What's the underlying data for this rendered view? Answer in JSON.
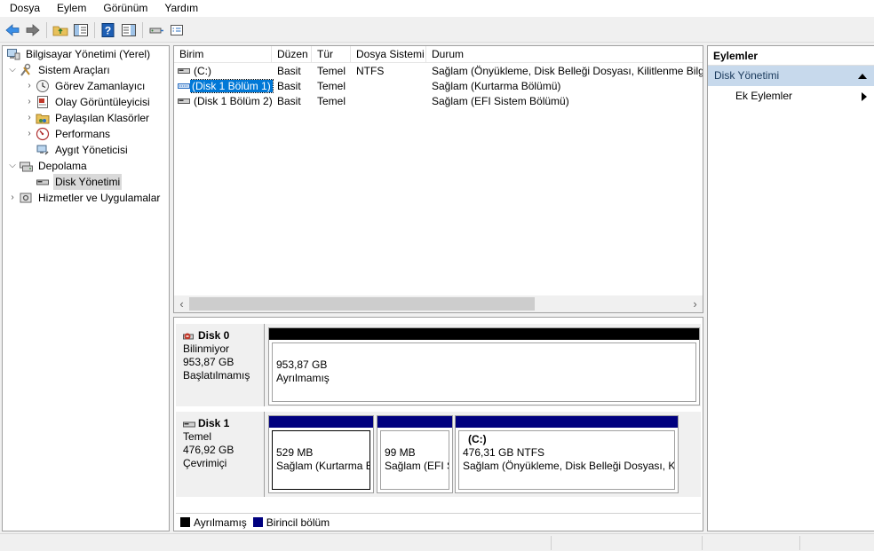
{
  "menu": [
    "Dosya",
    "Eylem",
    "Görünüm",
    "Yardım"
  ],
  "tree": {
    "root": "Bilgisayar Yönetimi (Yerel)",
    "system_tools": "Sistem Araçları",
    "task_scheduler": "Görev Zamanlayıcı",
    "event_viewer": "Olay Görüntüleyicisi",
    "shared_folders": "Paylaşılan Klasörler",
    "performance": "Performans",
    "device_manager": "Aygıt Yöneticisi",
    "storage": "Depolama",
    "disk_management": "Disk Yönetimi",
    "services": "Hizmetler ve Uygulamalar"
  },
  "list": {
    "columns": [
      "Birim",
      "Düzen",
      "Tür",
      "Dosya Sistemi",
      "Durum"
    ],
    "rows": [
      {
        "volume": "(C:)",
        "layout": "Basit",
        "type": "Temel",
        "fs": "NTFS",
        "status": "Sağlam (Önyükleme, Disk Belleği Dosyası, Kilitlenme Bilgisi"
      },
      {
        "volume": "(Disk 1 Bölüm 1)",
        "layout": "Basit",
        "type": "Temel",
        "fs": "",
        "status": "Sağlam (Kurtarma Bölümü)"
      },
      {
        "volume": "(Disk 1 Bölüm 2)",
        "layout": "Basit",
        "type": "Temel",
        "fs": "",
        "status": "Sağlam (EFI Sistem Bölümü)"
      }
    ]
  },
  "disks": [
    {
      "name": "Disk 0",
      "kind": "Bilinmiyor",
      "size": "953,87 GB",
      "state": "Başlatılmamış",
      "volumes": [
        {
          "name": "",
          "size": "953,87 GB",
          "desc": "Ayrılmamış"
        }
      ]
    },
    {
      "name": "Disk 1",
      "kind": "Temel",
      "size": "476,92 GB",
      "state": "Çevrimiçi",
      "volumes": [
        {
          "name": "",
          "size": "529 MB",
          "desc": "Sağlam (Kurtarma B"
        },
        {
          "name": "",
          "size": "99 MB",
          "desc": "Sağlam (EFI Si"
        },
        {
          "name": "(C:)",
          "size": "476,31 GB NTFS",
          "desc": "Sağlam (Önyükleme, Disk Belleği Dosyası, Kili"
        }
      ]
    }
  ],
  "legend": {
    "unallocated": "Ayrılmamış",
    "primary": "Birincil bölüm"
  },
  "actions": {
    "title": "Eylemler",
    "section": "Disk Yönetimi",
    "more": "Ek Eylemler"
  },
  "colors": {
    "unallocated": "#000000",
    "primary": "#00007f",
    "selection": "#0078d7",
    "actions_header": "#c7d9ec"
  }
}
